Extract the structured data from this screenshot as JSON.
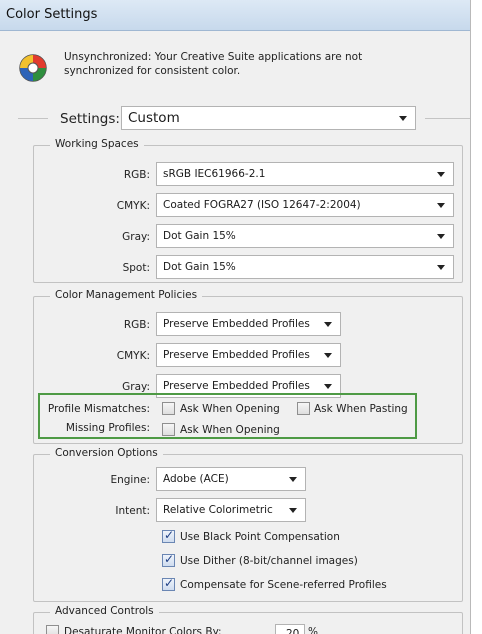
{
  "window": {
    "title": "Color Settings"
  },
  "sync": {
    "line1": "Unsynchronized: Your Creative Suite applications are not",
    "line2": "synchronized for consistent color."
  },
  "settings": {
    "label": "Settings:",
    "value": "Custom"
  },
  "working_spaces": {
    "title": "Working Spaces",
    "rows": [
      {
        "label": "RGB:",
        "value": "sRGB IEC61966-2.1"
      },
      {
        "label": "CMYK:",
        "value": "Coated FOGRA27 (ISO 12647-2:2004)"
      },
      {
        "label": "Gray:",
        "value": "Dot Gain 15%"
      },
      {
        "label": "Spot:",
        "value": "Dot Gain 15%"
      }
    ]
  },
  "policies": {
    "title": "Color Management Policies",
    "rows": [
      {
        "label": "RGB:",
        "value": "Preserve Embedded Profiles"
      },
      {
        "label": "CMYK:",
        "value": "Preserve Embedded Profiles"
      },
      {
        "label": "Gray:",
        "value": "Preserve Embedded Profiles"
      }
    ],
    "profile_mismatches_label": "Profile Mismatches:",
    "ask_when_opening": "Ask When Opening",
    "ask_when_pasting": "Ask When Pasting",
    "missing_profiles_label": "Missing Profiles:",
    "missing_ask_when_opening": "Ask When Opening"
  },
  "conversion": {
    "title": "Conversion Options",
    "engine_label": "Engine:",
    "engine_value": "Adobe (ACE)",
    "intent_label": "Intent:",
    "intent_value": "Relative Colorimetric",
    "use_bpc": "Use Black Point Compensation",
    "use_dither": "Use Dither (8-bit/channel images)",
    "compensate": "Compensate for Scene-referred Profiles"
  },
  "advanced": {
    "title": "Advanced Controls",
    "desaturate_label": "Desaturate Monitor Colors By:",
    "desaturate_value": "20",
    "desaturate_unit": "%"
  },
  "colors": {
    "highlight": "#4e9a45",
    "titlebar": "#c7d9ec",
    "dialog_bg": "#f0f0f0"
  },
  "icons": {
    "color_settings": "color-wheel-icon",
    "dropdown": "chevron-down-icon"
  }
}
